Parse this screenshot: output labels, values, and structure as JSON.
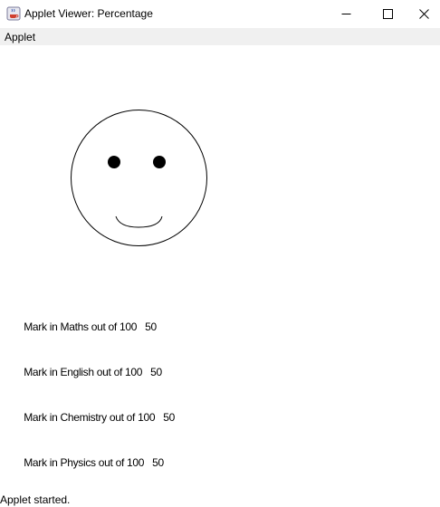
{
  "window": {
    "title": "Applet Viewer: Percentage",
    "controls": {
      "minimize_icon": "minimize-icon",
      "maximize_icon": "maximize-icon",
      "close_icon": "close-icon"
    }
  },
  "menubar": {
    "items": [
      {
        "label": "Applet"
      }
    ]
  },
  "applet": {
    "face": {
      "icon": "smiley-face-icon",
      "stroke": "#000000"
    },
    "marks": [
      {
        "label": "Mark in Maths out of 100",
        "value": "50"
      },
      {
        "label": "Mark in English out of 100",
        "value": "50"
      },
      {
        "label": "Mark in Chemistry out of 100",
        "value": "50"
      },
      {
        "label": "Mark in Physics out of 100",
        "value": "50"
      }
    ]
  },
  "status": {
    "text": "Applet started."
  },
  "colors": {
    "menubar_bg": "#f0f0f0",
    "background": "#ffffff",
    "text": "#000000"
  }
}
